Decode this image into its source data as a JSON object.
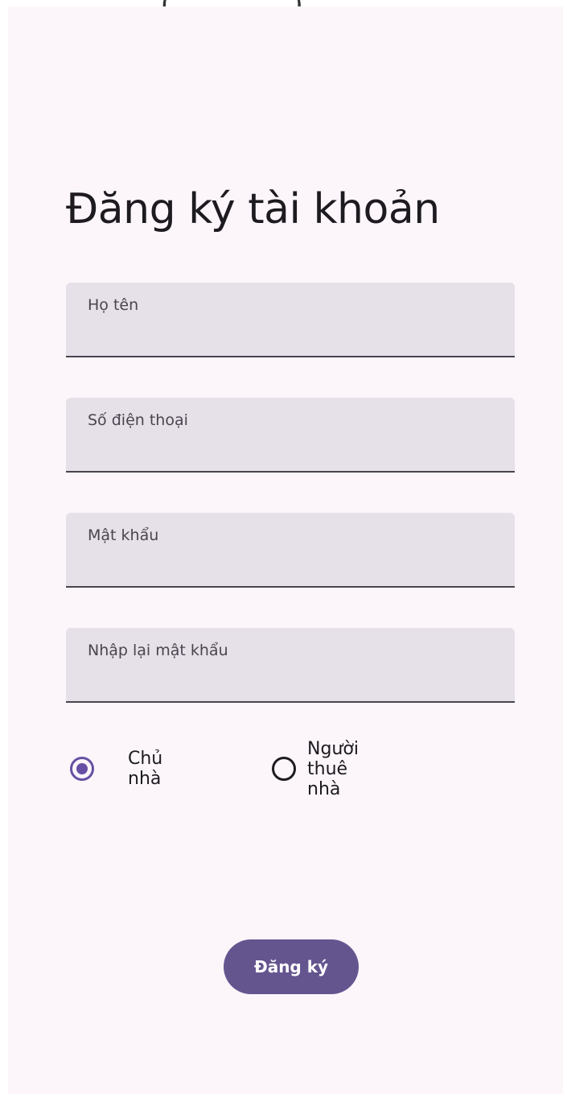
{
  "top_fragment": {
    "left_paren": "(",
    "right_paren": ")"
  },
  "page": {
    "title": "Đăng ký tài khoản"
  },
  "form": {
    "fields": [
      {
        "label": "Họ tên",
        "value": ""
      },
      {
        "label": "Số điện thoại",
        "value": ""
      },
      {
        "label": "Mật khẩu",
        "value": ""
      },
      {
        "label": "Nhập lại mật khẩu",
        "value": ""
      }
    ],
    "role_options": [
      {
        "label": "Chủ nhà",
        "selected": true
      },
      {
        "label": "Người thuê nhà",
        "selected": false
      }
    ],
    "submit_label": "Đăng ký"
  },
  "colors": {
    "background": "#fcf6fb",
    "field_fill": "#e6e0e8",
    "accent": "#6750a4",
    "button": "#65558f"
  },
  "icons": {
    "radio_selected": "radio-selected-icon",
    "radio_unselected": "radio-unselected-icon"
  }
}
